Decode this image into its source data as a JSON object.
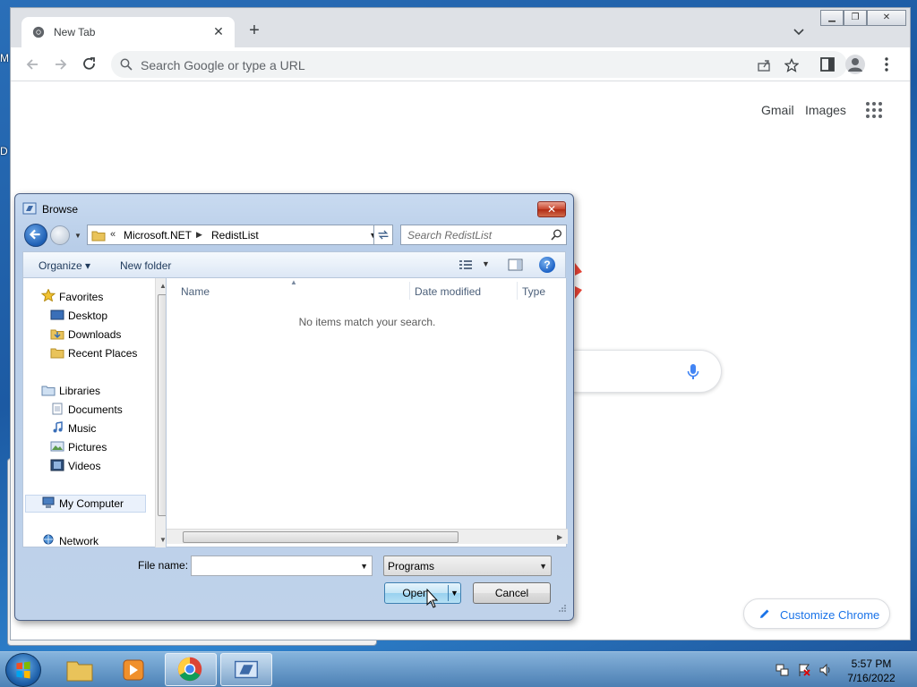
{
  "desktop": {
    "fragment_m": "M",
    "fragment_d": "D"
  },
  "chrome": {
    "tab_title": "New Tab",
    "omnibox_placeholder": "Search Google or type a URL",
    "gmail": "Gmail",
    "images": "Images",
    "customize": "Customize Chrome"
  },
  "dialog": {
    "title": "Browse",
    "breadcrumb_chevron": "«",
    "crumbs": [
      "Microsoft.NET",
      "RedistList"
    ],
    "search_placeholder": "Search RedistList",
    "organize": "Organize ▾",
    "new_folder": "New folder",
    "nav": {
      "favorites": "Favorites",
      "desktop": "Desktop",
      "downloads": "Downloads",
      "recent": "Recent Places",
      "libraries": "Libraries",
      "documents": "Documents",
      "music": "Music",
      "pictures": "Pictures",
      "videos": "Videos",
      "computer": "My Computer",
      "network": "Network"
    },
    "columns": [
      "Name",
      "Date modified",
      "Type"
    ],
    "empty_message": "No items match your search.",
    "file_name_label": "File name:",
    "file_name_value": "",
    "filter_value": "Programs",
    "open_label": "Open",
    "cancel_label": "Cancel",
    "close_glyph": "✕"
  },
  "taskbar": {
    "time": "5:57 PM",
    "date": "7/16/2022"
  },
  "colors": {
    "chrome_blue": "#1a73e8",
    "dialog_frame": "#bfd2ea",
    "close_red": "#c7432c"
  }
}
